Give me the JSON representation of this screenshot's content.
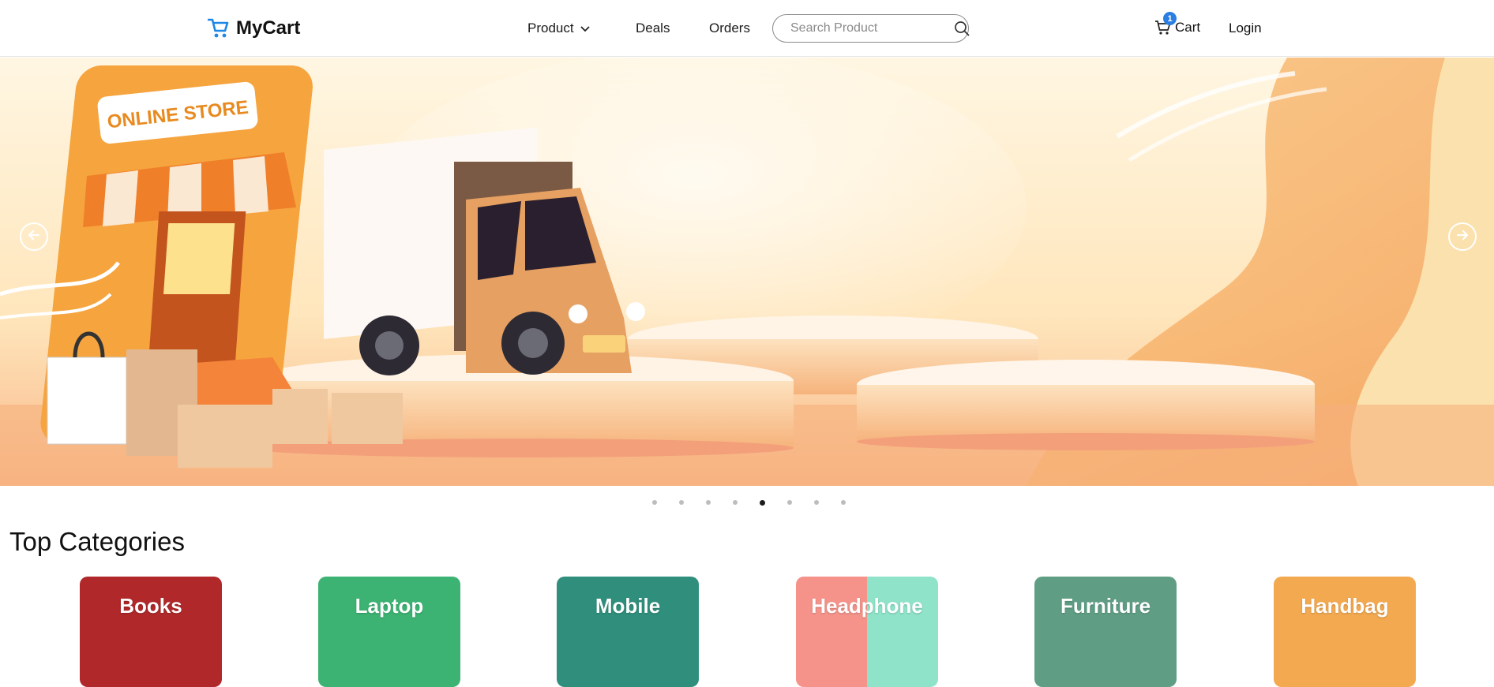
{
  "brand": {
    "name": "MyCart"
  },
  "nav": {
    "product": "Product",
    "deals": "Deals",
    "orders": "Orders",
    "search_placeholder": "Search Product",
    "cart": "Cart",
    "cart_count": "1",
    "login": "Login"
  },
  "hero": {
    "sign_text": "ONLINE STORE",
    "dots_total": 8,
    "active_dot": 5
  },
  "categories": {
    "title": "Top Categories",
    "items": [
      {
        "label": "Books",
        "color": "#b0282a"
      },
      {
        "label": "Laptop",
        "color": "#3cb372"
      },
      {
        "label": "Mobile",
        "color": "#2f8f7c"
      },
      {
        "label": "Headphone",
        "color": "#f5938a"
      },
      {
        "label": "Furniture",
        "color": "#5f9e85"
      },
      {
        "label": "Handbag",
        "color": "#f3a950"
      }
    ]
  },
  "colors": {
    "accent": "#2a7fe0",
    "brand_icon": "#1e88e5"
  }
}
